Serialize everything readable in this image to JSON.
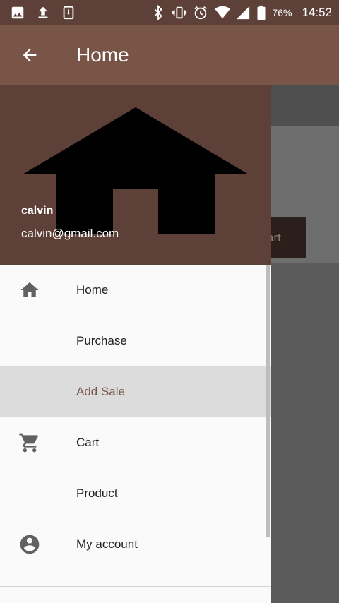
{
  "status_bar": {
    "battery": "76%",
    "time": "14:52"
  },
  "app_bar": {
    "title": "Home"
  },
  "background": {
    "button_partial_label": "art"
  },
  "drawer": {
    "user_name": "calvin",
    "user_email": "calvin@gmail.com",
    "menu": [
      {
        "label": "Home",
        "icon": "home-icon"
      },
      {
        "label": "Purchase",
        "icon": ""
      },
      {
        "label": "Add Sale",
        "icon": "",
        "selected": true
      },
      {
        "label": "Cart",
        "icon": "cart-icon"
      },
      {
        "label": "Product",
        "icon": ""
      },
      {
        "label": "My account",
        "icon": "account-circle-icon"
      }
    ]
  },
  "colors": {
    "primary": "#795548",
    "primary_dark": "#5d4037",
    "selected_bg": "#dcdcdc"
  }
}
